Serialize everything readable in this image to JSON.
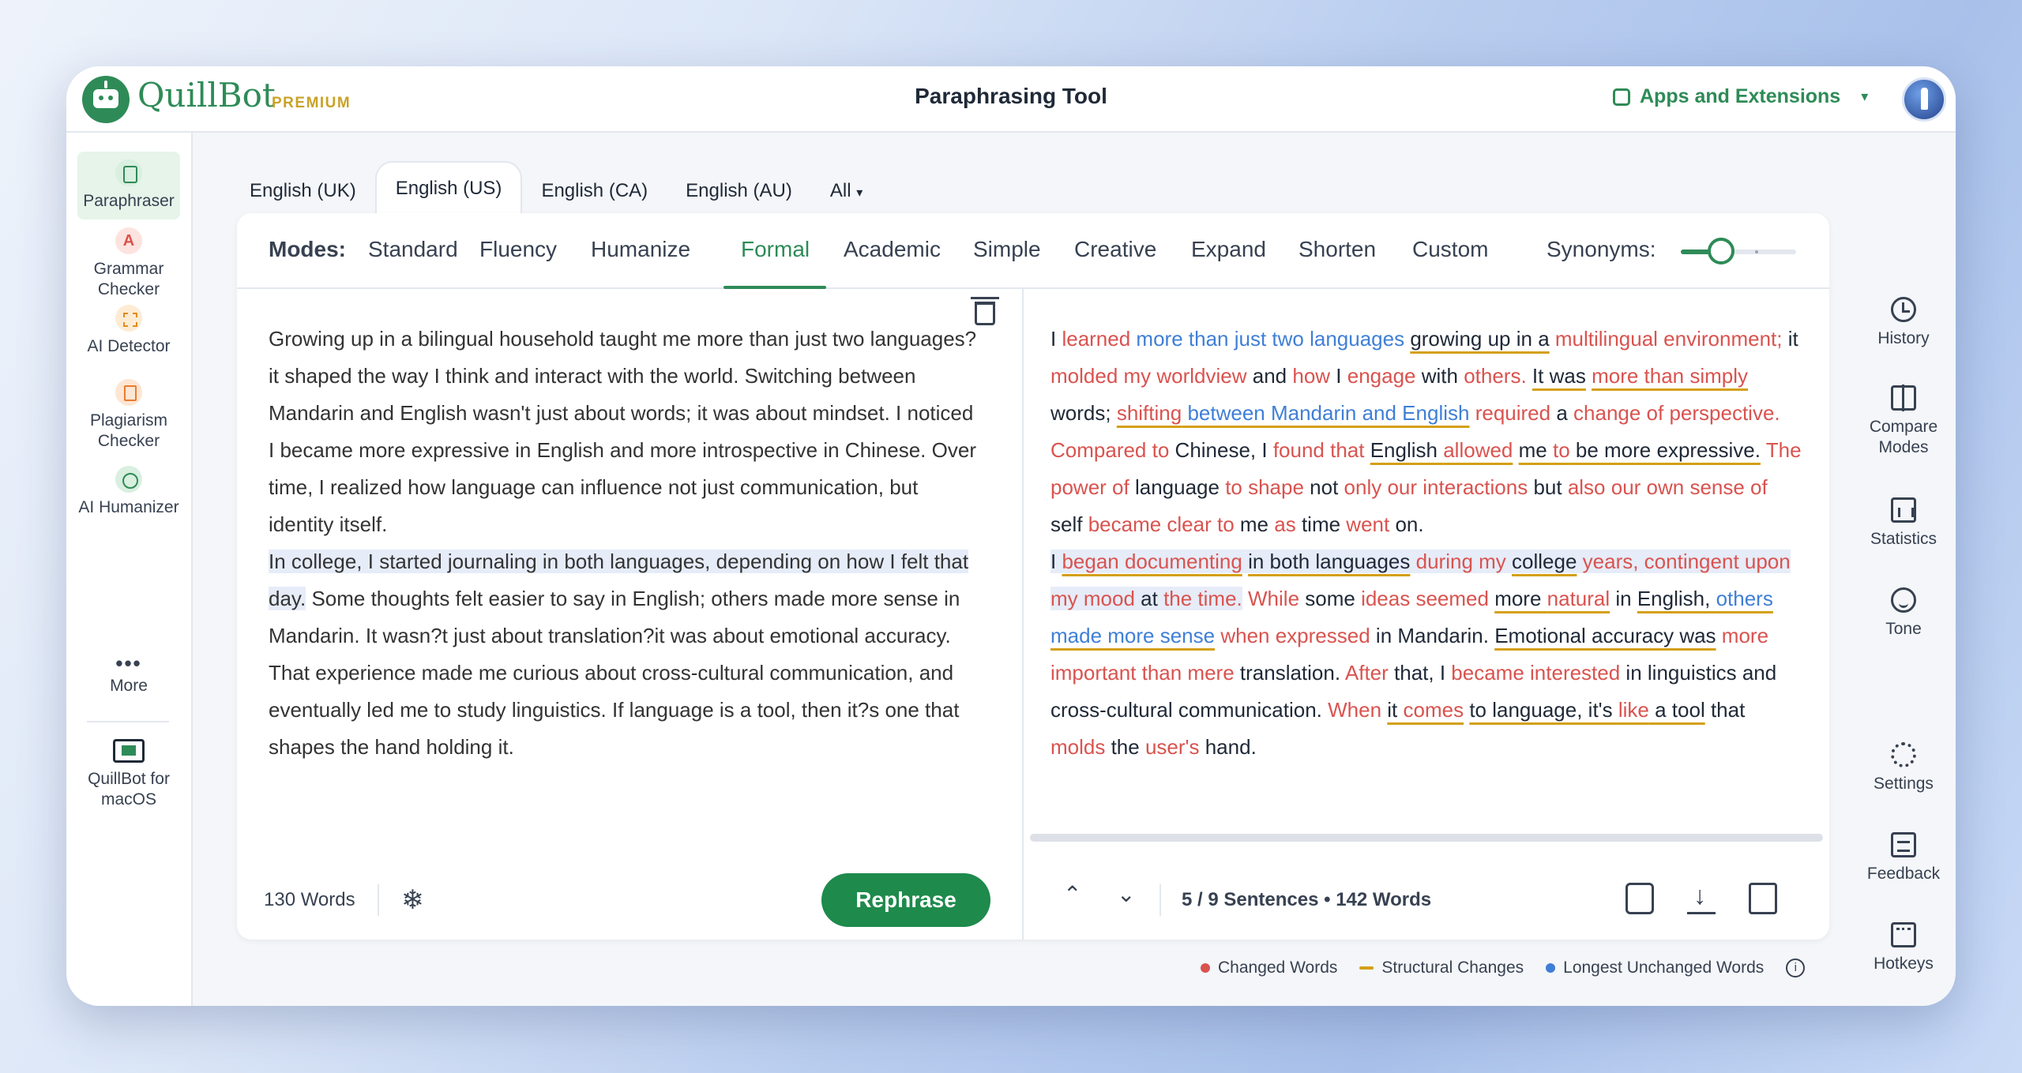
{
  "header": {
    "brand": "QuillBot",
    "tier": "PREMIUM",
    "title": "Paraphrasing Tool",
    "apps_label": "Apps and Extensions"
  },
  "sidebar": {
    "items": [
      {
        "label": "Paraphraser",
        "icon": "paraphraser-icon"
      },
      {
        "label": "Grammar Checker",
        "icon": "grammar-checker-icon"
      },
      {
        "label": "AI Detector",
        "icon": "ai-detector-icon"
      },
      {
        "label": "Plagiarism Checker",
        "icon": "plagiarism-checker-icon"
      },
      {
        "label": "AI Humanizer",
        "icon": "ai-humanizer-icon"
      },
      {
        "label": "More",
        "icon": "more-icon"
      },
      {
        "label": "QuillBot for macOS",
        "icon": "macos-icon"
      }
    ]
  },
  "languages": [
    "English (UK)",
    "English (US)",
    "English (CA)",
    "English (AU)",
    "All"
  ],
  "modes": {
    "label": "Modes:",
    "items": [
      "Standard",
      "Fluency",
      "Humanize",
      "Formal",
      "Academic",
      "Simple",
      "Creative",
      "Expand",
      "Shorten",
      "Custom"
    ],
    "active": "Formal",
    "synonyms_label": "Synonyms:",
    "synonyms_level": 0.2
  },
  "input": {
    "para1": "Growing up in a bilingual household taught me more than just two languages?it shaped the way I think and interact with the world. Switching between Mandarin and English wasn't just about words; it was about mindset. I noticed I became more expressive in English and more introspective in Chinese. Over time, I realized how language can influence not just communication, but identity itself.",
    "para2_highlighted": "In college, I started journaling in both languages, depending on how I felt that day.",
    "para2_rest": " Some thoughts felt easier to say in English; others made more sense in Mandarin. It wasn?t just about translation?it was about emotional accuracy. That experience made me curious about cross-cultural communication, and eventually led me to study linguistics. If language is a tool, then it?s one that shapes the hand holding it.",
    "word_count": "130 Words",
    "rephrase_label": "Rephrase"
  },
  "output": {
    "sentences": "5 / 9 Sentences",
    "word_count": "142 Words"
  },
  "legend": {
    "changed": "Changed Words",
    "structural": "Structural Changes",
    "unchanged": "Longest Unchanged Words"
  },
  "right_rail": [
    "History",
    "Compare Modes",
    "Statistics",
    "Tone",
    "Settings",
    "Feedback",
    "Hotkeys"
  ],
  "colors": {
    "brand_green": "#2e8b57",
    "changed": "#d9534f",
    "structural": "#d4a017",
    "unchanged": "#3f7fd6"
  }
}
